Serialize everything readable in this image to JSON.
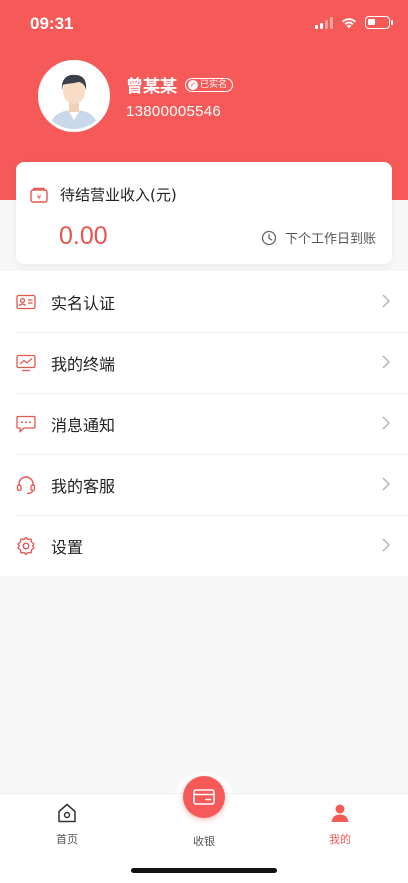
{
  "status_bar": {
    "time": "09:31",
    "battery_level": 0.35
  },
  "profile": {
    "name": "曾某某",
    "verified_badge": "已实名",
    "phone": "13800005546"
  },
  "income_card": {
    "title": "待结营业收入(元)",
    "amount": "0.00",
    "settle_note": "下个工作日到账"
  },
  "menu": [
    {
      "label": "实名认证",
      "icon": "id-card-icon"
    },
    {
      "label": "我的终端",
      "icon": "terminal-icon"
    },
    {
      "label": "消息通知",
      "icon": "message-icon"
    },
    {
      "label": "我的客服",
      "icon": "headset-icon"
    },
    {
      "label": "设置",
      "icon": "gear-icon"
    }
  ],
  "tabbar": {
    "home": "首页",
    "cashier": "收银",
    "mine": "我的",
    "active": "mine"
  },
  "colors": {
    "accent": "#f55a58",
    "amount": "#e8554f"
  }
}
